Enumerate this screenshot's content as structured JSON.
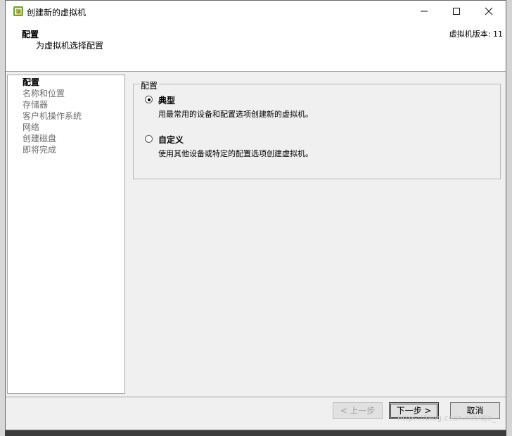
{
  "window": {
    "title": "创建新的虚拟机",
    "controls": {
      "minimize": "—",
      "maximize": "☐",
      "close": "✕"
    }
  },
  "header": {
    "title": "配置",
    "subtitle": "为虚拟机选择配置",
    "version": "虚拟机版本: 11"
  },
  "sidebar": {
    "items": [
      {
        "label": "配置",
        "active": true
      },
      {
        "label": "名称和位置",
        "active": false
      },
      {
        "label": "存储器",
        "active": false
      },
      {
        "label": "客户机操作系统",
        "active": false
      },
      {
        "label": "网络",
        "active": false
      },
      {
        "label": "创建磁盘",
        "active": false
      },
      {
        "label": "即将完成",
        "active": false
      }
    ]
  },
  "config_group": {
    "legend": "配置",
    "options": [
      {
        "label": "典型",
        "description": "用最常用的设备和配置选项创建新的虚拟机。",
        "checked": true
      },
      {
        "label": "自定义",
        "description": "使用其他设备或特定的配置选项创建虚拟机。",
        "checked": false
      }
    ]
  },
  "buttons": {
    "back": "< 上一步",
    "next": "下一步 >",
    "cancel": "取消"
  },
  "watermark": "https://blog.csdn.net/dje_"
}
